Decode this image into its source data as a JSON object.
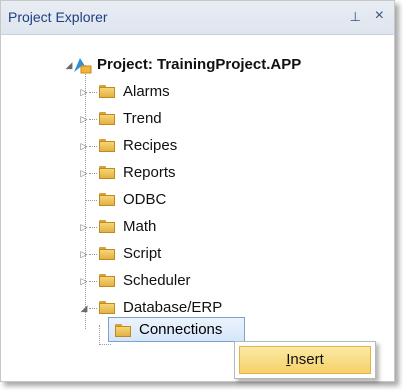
{
  "panel": {
    "title": "Project Explorer",
    "pin_glyph": "⊥",
    "close_glyph": "×"
  },
  "tree": {
    "root": {
      "label": "Project: TrainingProject.APP",
      "icon": "project-icon",
      "expanded": true
    },
    "items": [
      {
        "label": "Alarms",
        "icon": "folder-icon",
        "expandable": true
      },
      {
        "label": "Trend",
        "icon": "folder-icon",
        "expandable": true
      },
      {
        "label": "Recipes",
        "icon": "folder-icon",
        "expandable": true
      },
      {
        "label": "Reports",
        "icon": "folder-icon",
        "expandable": true
      },
      {
        "label": "ODBC",
        "icon": "folder-icon",
        "expandable": false
      },
      {
        "label": "Math",
        "icon": "folder-icon",
        "expandable": true
      },
      {
        "label": "Script",
        "icon": "folder-icon",
        "expandable": true
      },
      {
        "label": "Scheduler",
        "icon": "folder-icon",
        "expandable": true
      },
      {
        "label": "Database/ERP",
        "icon": "folder-icon",
        "expandable": true,
        "expanded": true
      },
      {
        "label": "Connections",
        "icon": "folder-icon",
        "selected": true
      }
    ]
  },
  "context_menu": {
    "items": [
      {
        "label_prefix": "",
        "label_underlined": "I",
        "label_rest": "nsert"
      }
    ]
  },
  "colors": {
    "title_text": "#1d3f84",
    "selection_border": "#7da2ce",
    "menu_highlight": "#f5d16a"
  }
}
